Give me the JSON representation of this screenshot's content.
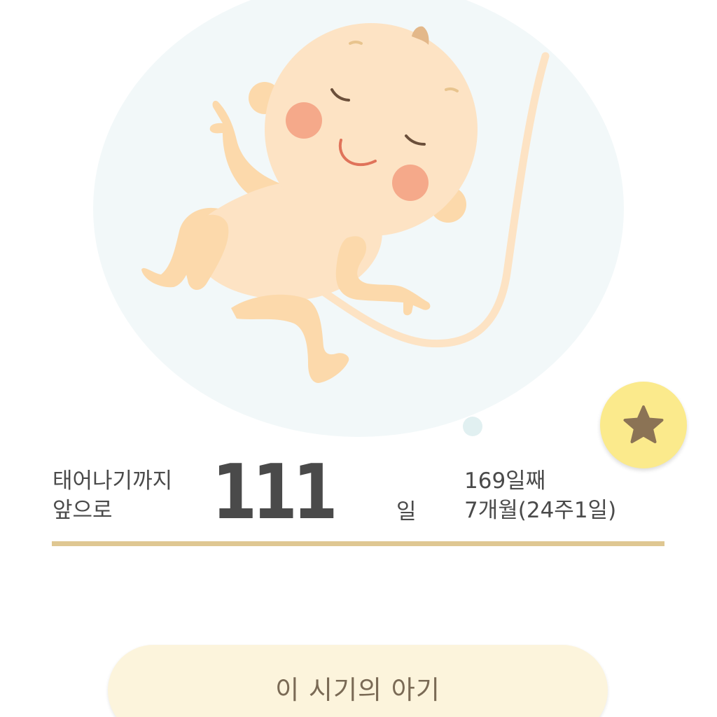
{
  "countdown": {
    "label_line1": "태어나기까지",
    "label_line2": "앞으로",
    "days_remaining": "111",
    "unit": "일"
  },
  "pregnancy_status": {
    "day_count": "169일째",
    "month_week": "7개월(24주1일)"
  },
  "actions": {
    "baby_info_label": "이 시기의 아기"
  },
  "icons": {
    "favorite": "star-icon",
    "illustration": "fetus-illustration"
  },
  "colors": {
    "bubble": "#f2f8f9",
    "favorite_button": "#fbea8c",
    "star": "#8b7355",
    "divider": "#dfc792",
    "action_button": "#fcf4dc",
    "text": "#4a4a4a"
  }
}
